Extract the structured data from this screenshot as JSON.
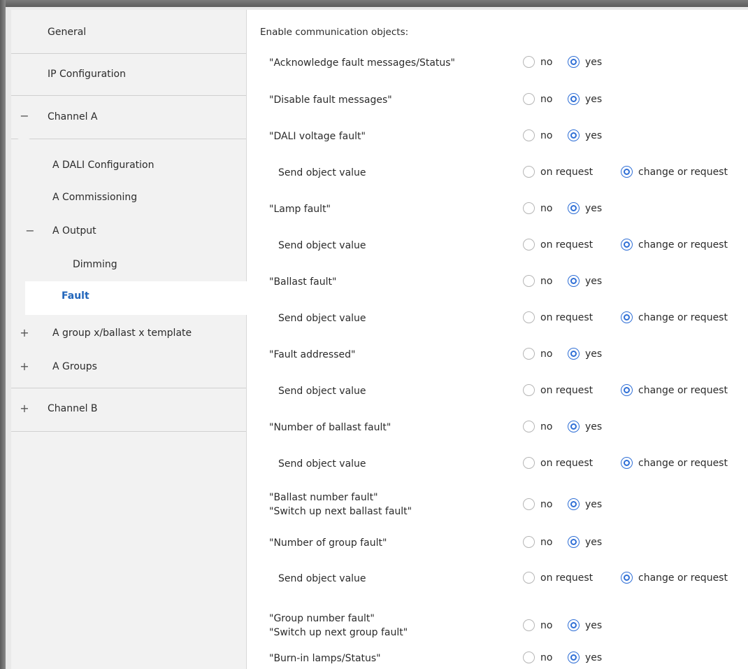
{
  "sidebar": {
    "items": [
      {
        "label": "General"
      },
      {
        "label": "IP Configuration"
      },
      {
        "label": "Channel A",
        "toggle": "−"
      },
      {
        "label": "A DALI Configuration"
      },
      {
        "label": "A Commissioning"
      },
      {
        "label": "A Output",
        "toggle": "−"
      },
      {
        "label": "Dimming"
      },
      {
        "label": "Fault"
      },
      {
        "label": "A group x/ballast x template",
        "toggle": "+"
      },
      {
        "label": "A Groups",
        "toggle": "+"
      },
      {
        "label": "Channel B",
        "toggle": "+"
      }
    ]
  },
  "main": {
    "header": "Enable communication objects:",
    "rows": [
      {
        "label": "\"Acknowledge fault messages/Status\"",
        "options": [
          "no",
          "yes"
        ],
        "selected": "yes"
      },
      {
        "label": "\"Disable fault messages\"",
        "options": [
          "no",
          "yes"
        ],
        "selected": "yes"
      },
      {
        "label": "\"DALI voltage fault\"",
        "options": [
          "no",
          "yes"
        ],
        "selected": "yes"
      },
      {
        "label": "Send object value",
        "options": [
          "on request",
          "change or request"
        ],
        "selected": "change or request"
      },
      {
        "label": "\"Lamp fault\"",
        "options": [
          "no",
          "yes"
        ],
        "selected": "yes"
      },
      {
        "label": "Send object value",
        "options": [
          "on request",
          "change or request"
        ],
        "selected": "change or request"
      },
      {
        "label": "\"Ballast fault\"",
        "options": [
          "no",
          "yes"
        ],
        "selected": "yes"
      },
      {
        "label": "Send object value",
        "options": [
          "on request",
          "change or request"
        ],
        "selected": "change or request"
      },
      {
        "label": "\"Fault addressed\"",
        "options": [
          "no",
          "yes"
        ],
        "selected": "yes"
      },
      {
        "label": "Send object value",
        "options": [
          "on request",
          "change or request"
        ],
        "selected": "change or request"
      },
      {
        "label": "\"Number of ballast fault\"",
        "options": [
          "no",
          "yes"
        ],
        "selected": "yes"
      },
      {
        "label": "Send object value",
        "options": [
          "on request",
          "change or request"
        ],
        "selected": "change or request"
      },
      {
        "label": "\"Ballast number fault\"",
        "label2": "\"Switch up next ballast fault\"",
        "options": [
          "no",
          "yes"
        ],
        "selected": "yes"
      },
      {
        "label": "\"Number of group fault\"",
        "options": [
          "no",
          "yes"
        ],
        "selected": "yes"
      },
      {
        "label": "Send object value",
        "options": [
          "on request",
          "change or request"
        ],
        "selected": "change or request"
      },
      {
        "label": "\"Group number fault\"",
        "label2": "\"Switch up next group fault\"",
        "options": [
          "no",
          "yes"
        ],
        "selected": "yes"
      },
      {
        "label": "\"Burn-in lamps/Status\"",
        "options": [
          "no",
          "yes"
        ],
        "selected": "yes"
      }
    ]
  },
  "colors": {
    "accent": "#2f6fd6",
    "selected_text": "#2266bb",
    "sidebar_bg": "#f2f2f2"
  }
}
